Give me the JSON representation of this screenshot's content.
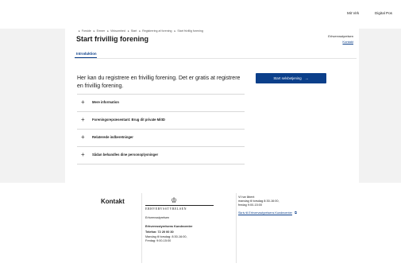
{
  "topbar": {
    "links": [
      "Mit Virk",
      "Digital Pos"
    ]
  },
  "breadcrumb": [
    "Forside",
    "Emner",
    "Virksomhed",
    "Start",
    "Registrering af forening",
    "Start frivillig forening"
  ],
  "page": {
    "title": "Start frivillig forening",
    "org_name": "Erhvervsstyrelsen",
    "org_contact": "Kontakt",
    "tab_label": "Introduktion",
    "intro": "Her kan du registrere en frivillig forening. Det er gratis at registrere en frivillig forening.",
    "start_button": "Start selvbetjening",
    "start_arrow": "→"
  },
  "accordion": [
    {
      "label": "Mere information"
    },
    {
      "label": "Foreningsrepræsentant: Brug dit private MitID"
    },
    {
      "label": "Relaterede indberetninger"
    },
    {
      "label": "Sådan behandles dine personoplysninger"
    }
  ],
  "footer": {
    "title": "Kontakt",
    "logo_text": "ERHVERVSSTYRELSEN",
    "col1": {
      "org": "Erhvervsstyrelsen",
      "center": "Erhvervsstyrelsens Kundecenter",
      "phone": "Telefon: 72 20 00 30",
      "hours1": "Mandag til torsdag: 8:30-16:00,",
      "hours2": "Fredag: 9:00-15:00"
    },
    "col2": {
      "line1": "Vi har åbent",
      "line2": "mandag til torsdag 8:30-16:00,",
      "line3": "fredag 9:00-15:00",
      "link": "Skriv til Erhvervsstyrelsens Kundecenter"
    }
  },
  "colors": {
    "accent": "#0b3f8a",
    "page_bg": "#f2f2f2"
  }
}
